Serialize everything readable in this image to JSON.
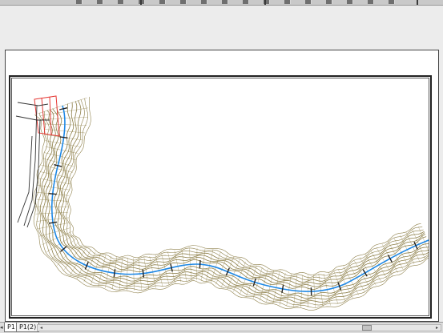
{
  "toolbar": {
    "button_count": 16
  },
  "layout_tabs": [
    {
      "label": "P1",
      "active": true
    },
    {
      "label": "P1(2)",
      "active": false
    }
  ],
  "drawing": {
    "river_color": "#1e88e5",
    "terrain_color": "#7a6a2a",
    "boundary_color": "#e53935",
    "road_color": "#333333"
  },
  "icons": {
    "tab_nav": "tab-nav-arrow-icon",
    "scroll_left": "scroll-left-arrow-icon",
    "scroll_right": "scroll-right-arrow-icon"
  }
}
